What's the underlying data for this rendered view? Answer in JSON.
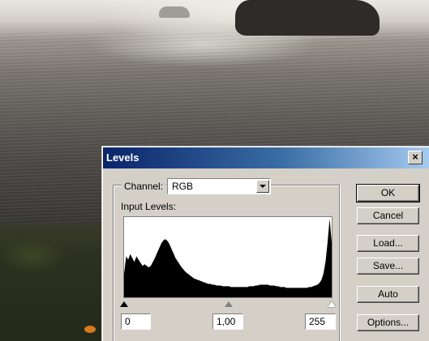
{
  "dialog": {
    "title": "Levels",
    "close_label": "×"
  },
  "channel": {
    "label": "Channel:",
    "value": "RGB"
  },
  "input_levels": {
    "label": "Input Levels:",
    "black": "0",
    "gamma": "1,00",
    "white": "255"
  },
  "buttons": {
    "ok": "OK",
    "cancel": "Cancel",
    "load": "Load...",
    "save": "Save...",
    "auto": "Auto",
    "options": "Options..."
  },
  "histogram": {
    "color": "#000000",
    "values": [
      30,
      52,
      48,
      55,
      50,
      45,
      52,
      48,
      44,
      40,
      42,
      40,
      38,
      40,
      45,
      50,
      56,
      62,
      68,
      72,
      74,
      72,
      68,
      62,
      56,
      50,
      46,
      42,
      38,
      35,
      32,
      30,
      28,
      26,
      24,
      23,
      22,
      21,
      20,
      19,
      18,
      17,
      17,
      16,
      16,
      15,
      15,
      15,
      14,
      14,
      14,
      14,
      13,
      13,
      13,
      13,
      13,
      13,
      13,
      13,
      13,
      14,
      14,
      14,
      15,
      15,
      16,
      16,
      16,
      16,
      16,
      15,
      15,
      15,
      14,
      14,
      13,
      13,
      13,
      12,
      12,
      12,
      12,
      12,
      12,
      12,
      12,
      12,
      12,
      12,
      13,
      13,
      14,
      15,
      16,
      18,
      22,
      30,
      45,
      70,
      100,
      70
    ]
  }
}
